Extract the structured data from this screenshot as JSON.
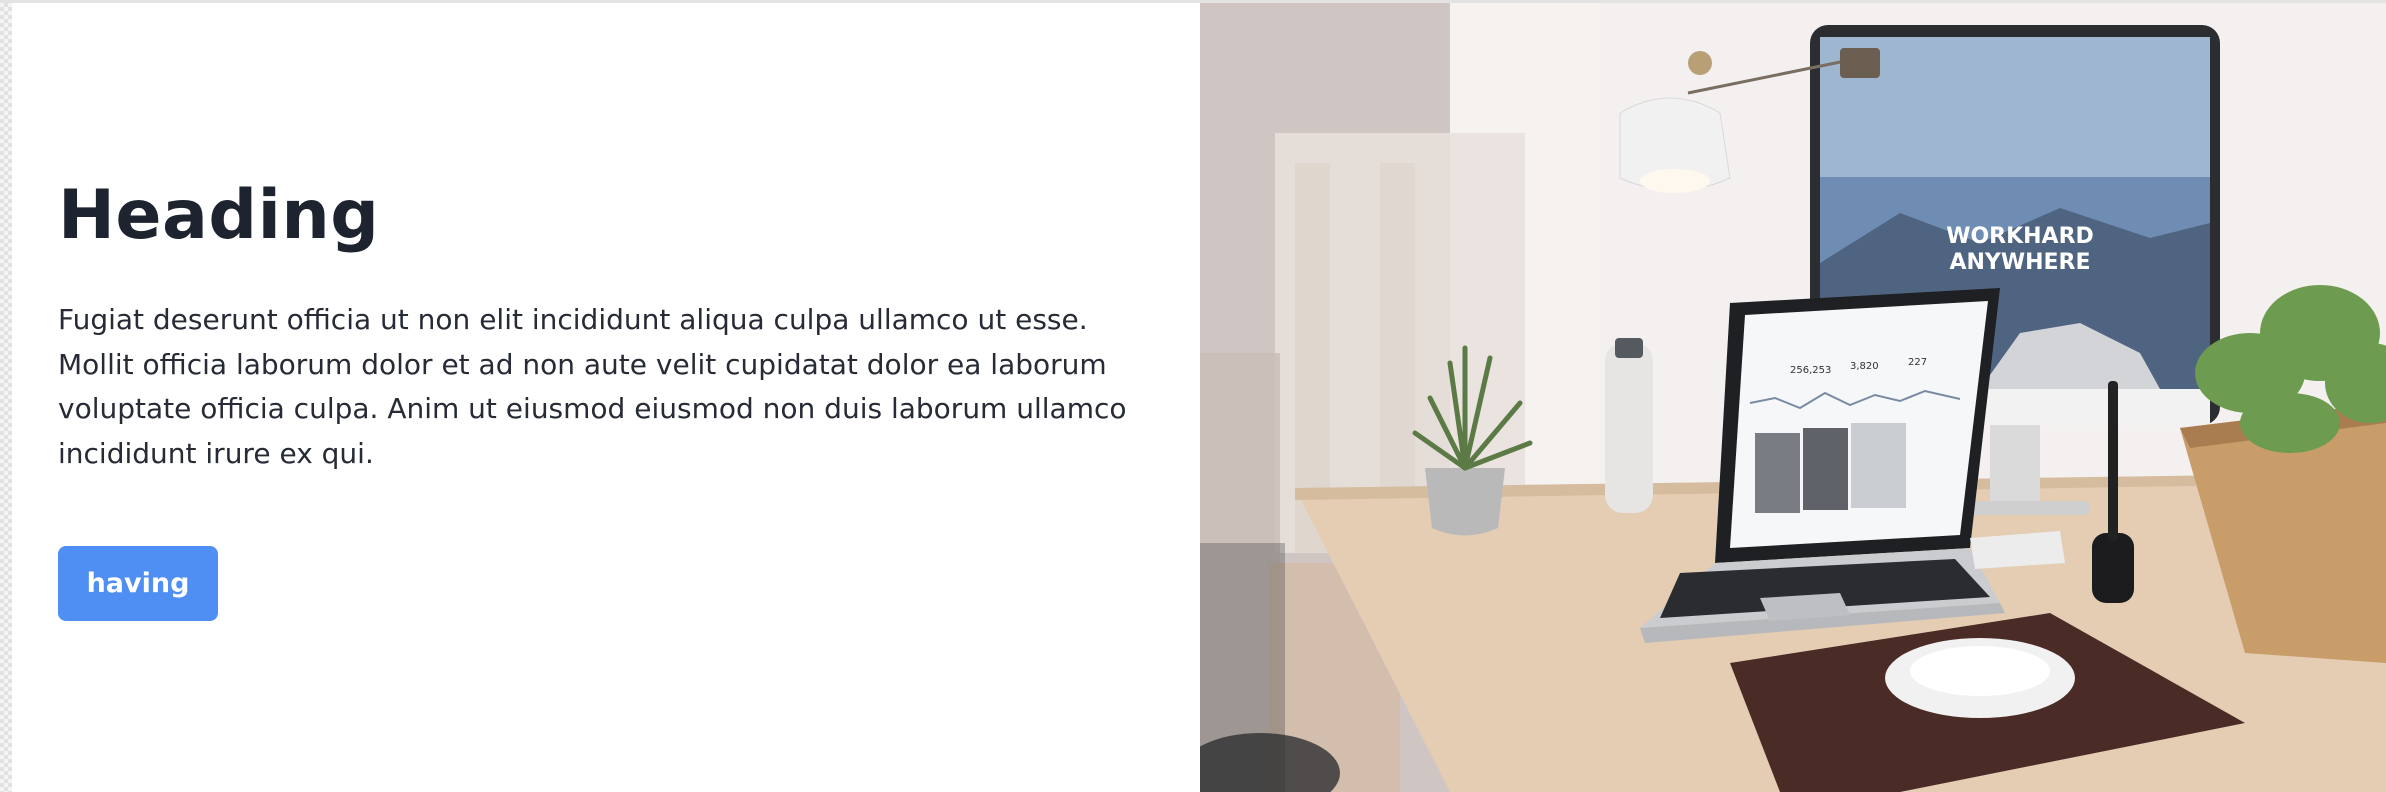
{
  "hero": {
    "heading": "Heading",
    "body": "Fugiat deserunt officia ut non elit incididunt aliqua culpa ullamco ut esse. Mollit officia laborum dolor et ad non aute velit cupidatat dolor ea laborum voluptate officia culpa. Anim ut eiusmod eiusmod non duis laborum ullamco incididunt irure ex qui.",
    "button_label": "having"
  },
  "image": {
    "monitor_line1": "WORKHARD",
    "monitor_line2": "ANYWHERE",
    "laptop_stats": [
      "256,253",
      "3,820",
      "227"
    ]
  },
  "colors": {
    "button": "#4f8ef3",
    "heading": "#1e2330"
  }
}
